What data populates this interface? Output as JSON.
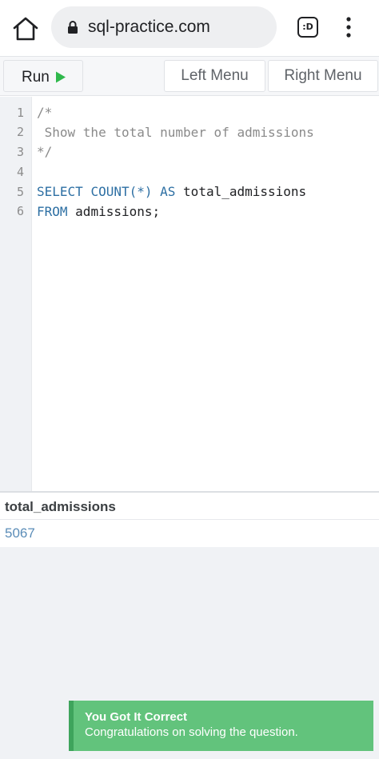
{
  "browser": {
    "url": "sql-practice.com",
    "tab_label": ":D"
  },
  "toolbar": {
    "run_label": "Run",
    "left_menu_label": "Left Menu",
    "right_menu_label": "Right Menu"
  },
  "editor": {
    "line_numbers": [
      "1",
      "2",
      "3",
      "4",
      "5",
      "6"
    ],
    "lines": {
      "l1": "/*",
      "l2": " Show the total number of admissions",
      "l3": "*/",
      "l5_kw1": "SELECT",
      "l5_fn": "COUNT(*)",
      "l5_kw2": "AS",
      "l5_alias": "total_admissions",
      "l6_kw": "FROM",
      "l6_table": "admissions;"
    }
  },
  "results": {
    "column": "total_admissions",
    "value": "5067"
  },
  "toast": {
    "title": "You Got It Correct",
    "message": "Congratulations on solving the question."
  },
  "colors": {
    "accent_green": "#62c37c",
    "keyword_blue": "#2d6fa3",
    "result_blue": "#5b8db8"
  }
}
